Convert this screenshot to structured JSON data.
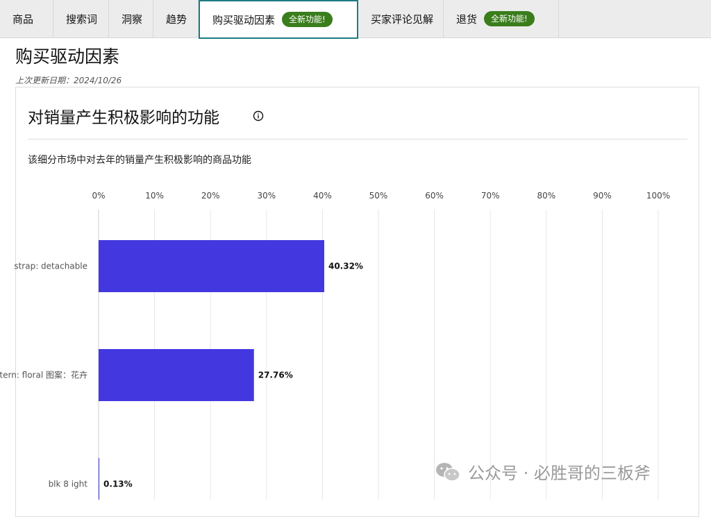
{
  "tabs": [
    {
      "label": "商品"
    },
    {
      "label": "搜索词"
    },
    {
      "label": "洞察"
    },
    {
      "label": "趋势"
    },
    {
      "label": "购买驱动因素",
      "badge": "全新功能!",
      "active": true
    },
    {
      "label": "买家评论见解"
    },
    {
      "label": "退货",
      "badge": "全新功能!"
    }
  ],
  "page": {
    "title": "购买驱动因素",
    "updated": "上次更新日期：2024/10/26"
  },
  "card": {
    "title": "对销量产生积极影响的功能",
    "subtitle": "该细分市场中对去年的销量产生积极影响的商品功能"
  },
  "chart_data": {
    "type": "bar",
    "orientation": "horizontal",
    "categories": [
      "strap: detachable",
      "pattern: floral 图案：花卉",
      "blk 8 ight"
    ],
    "values": [
      40.32,
      27.76,
      0.13
    ],
    "value_labels": [
      "40.32%",
      "27.76%",
      "0.13%"
    ],
    "xlim": [
      0,
      100
    ],
    "x_ticks": [
      "0%",
      "10%",
      "20%",
      "30%",
      "40%",
      "50%",
      "60%",
      "70%",
      "80%",
      "90%",
      "100%"
    ],
    "grid": true,
    "bar_color": "#4338e0"
  },
  "watermark": "公众号 · 必胜哥的三板斧",
  "colors": {
    "badge": "#3a7d1c",
    "active_tab_border": "#1e7b85",
    "bar": "#4338e0"
  }
}
